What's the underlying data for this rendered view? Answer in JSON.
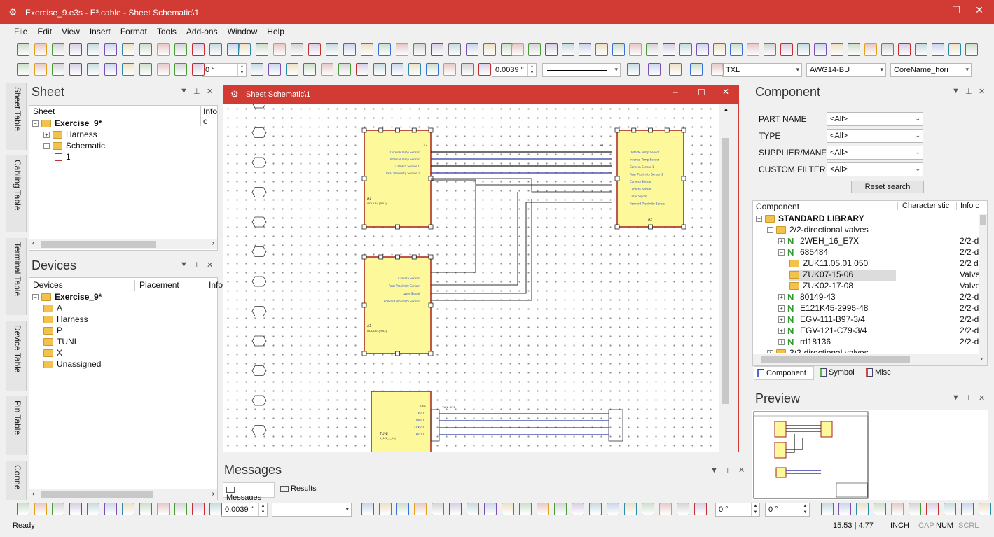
{
  "window": {
    "title": "Exercise_9.e3s - E³.cable - Sheet Schematic\\1"
  },
  "menu": [
    "File",
    "Edit",
    "View",
    "Insert",
    "Format",
    "Tools",
    "Add-ons",
    "Window",
    "Help"
  ],
  "toolbar2": {
    "angle": "0 °",
    "width": "0.0039 \"",
    "wire_type": "TXL",
    "wire_gauge": "AWG14-BU",
    "core_name": "CoreName_hori"
  },
  "side_tabs": [
    "Sheet Table",
    "Cabling Table",
    "Terminal Table",
    "Device Table",
    "Pin Table",
    "Conne"
  ],
  "sheet_panel": {
    "title": "Sheet",
    "col1": "Sheet",
    "col2": "Info c",
    "tree": [
      {
        "label": "Exercise_9*",
        "level": 0,
        "bold": true
      },
      {
        "label": "Harness",
        "level": 1
      },
      {
        "label": "Schematic",
        "level": 1
      },
      {
        "label": "1",
        "level": 2
      }
    ]
  },
  "devices_panel": {
    "title": "Devices",
    "col1": "Devices",
    "col2": "Placement",
    "col3": "Info",
    "tree": [
      {
        "label": "Exercise_9*",
        "level": 0,
        "bold": true
      },
      {
        "label": "A",
        "level": 1
      },
      {
        "label": "Harness",
        "level": 1
      },
      {
        "label": "P",
        "level": 1
      },
      {
        "label": "TUNI",
        "level": 1
      },
      {
        "label": "X",
        "level": 1
      },
      {
        "label": "Unassigned",
        "level": 1
      }
    ]
  },
  "schematic_window": {
    "title": "Sheet Schematic\\1"
  },
  "messages": {
    "title": "Messages",
    "tabs": [
      "Messages",
      "Results"
    ]
  },
  "component_panel": {
    "title": "Component",
    "filters": [
      {
        "label": "PART NAME",
        "value": "<All>"
      },
      {
        "label": "TYPE",
        "value": "<All>"
      },
      {
        "label": "SUPPLIER/MANF",
        "value": "<All>"
      },
      {
        "label": "CUSTOM FILTER",
        "value": "<All>"
      }
    ],
    "reset": "Reset search",
    "cols": [
      "Component",
      "Characteristic",
      "Info c"
    ],
    "tree": [
      {
        "label": "STANDARD LIBRARY",
        "level": 0,
        "bold": true,
        "info": ""
      },
      {
        "label": "2/2-directional valves",
        "level": 1,
        "info": ""
      },
      {
        "label": "2WEH_16_E7X",
        "level": 2,
        "info": "2/2-d"
      },
      {
        "label": "685484",
        "level": 2,
        "info": "2/2-d"
      },
      {
        "label": "ZUK11.05.01.050",
        "level": 3,
        "info": "2/2 d"
      },
      {
        "label": "ZUK07-15-06",
        "level": 3,
        "info": "Valve",
        "selected": true
      },
      {
        "label": "ZUK02-17-08",
        "level": 3,
        "info": "Valve"
      },
      {
        "label": "80149-43",
        "level": 2,
        "info": "2/2-d"
      },
      {
        "label": "E121K45-2995-48",
        "level": 2,
        "info": "2/2-d"
      },
      {
        "label": "EGV-111-B97-3/4",
        "level": 2,
        "info": "2/2-d"
      },
      {
        "label": "EGV-121-C79-3/4",
        "level": 2,
        "info": "2/2-d"
      },
      {
        "label": "rd18136",
        "level": 2,
        "info": "2/2-d"
      },
      {
        "label": "3/2-directional valves",
        "level": 1,
        "info": ""
      }
    ],
    "tabs": [
      "Component",
      "Symbol",
      "Misc"
    ]
  },
  "preview_panel": {
    "title": "Preview"
  },
  "bottom_toolbar": {
    "width": "0.0039 \"",
    "angle1": "0 °",
    "angle2": "0 °"
  },
  "status": {
    "ready": "Ready",
    "coords": "15.53 | 4.77",
    "unit": "INCH",
    "cap": "CAP",
    "num": "NUM",
    "scrl": "SCRL"
  },
  "schematic_labels": {
    "block1_title": "A1",
    "block1_sub": "ODUL3/1(7ULI)",
    "connector1": "X2",
    "block2_title": "A1",
    "block2_sub": "ODUL3/1(7ULI)",
    "block3_title": "A2",
    "connector3": "X4",
    "block4_title": "TUNI",
    "block4_sub": "1_1(1_1_14)",
    "block4_conn": "CN1",
    "cable": "TUNI CN1",
    "pins_top": [
      "Outside Temp Sensor",
      "Internal Temp Sensor",
      "Camera Sensor 1",
      "Rear Proximity Sensor 2"
    ],
    "pins_right": [
      "Outside Temp Sensor",
      "Internal Temp Sensor",
      "Camera Sensor 1",
      "Rear Proximity Sensor 2",
      "Camera Sensor",
      "Camera Sensor",
      "Laser Signal",
      "Forward Proximity Sensor"
    ],
    "pins_mid": [
      "Camera Sensor",
      "Rear Proximity Sensor",
      "Laser Signal",
      "Forward Proximity Sensor"
    ],
    "pins_bot": [
      "TXRD",
      "LNRD",
      "CLKRD",
      "PRDO"
    ]
  }
}
